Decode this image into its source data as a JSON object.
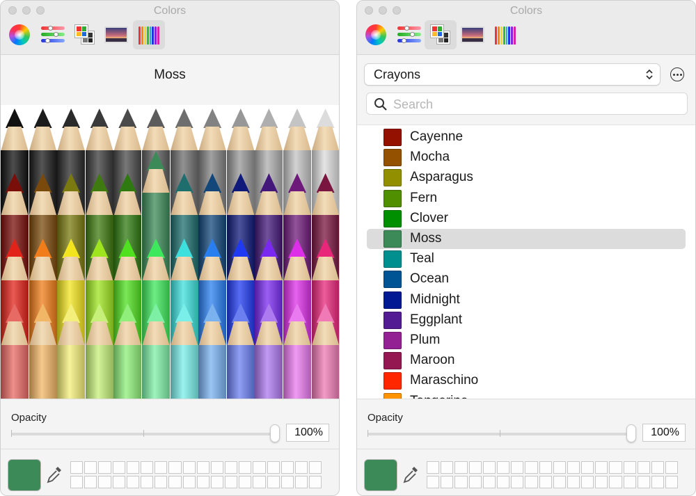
{
  "left_window": {
    "title": "Colors",
    "selected_name": "Moss",
    "opacity_label": "Opacity",
    "opacity_value": "100%",
    "opacity_fraction": 1.0,
    "current_color": "#3b8a58"
  },
  "right_window": {
    "title": "Colors",
    "list_name": "Crayons",
    "search_placeholder": "Search",
    "opacity_label": "Opacity",
    "opacity_value": "100%",
    "opacity_fraction": 1.0,
    "current_color": "#3b8a58",
    "selected_item": "Moss",
    "items": [
      {
        "name": "Cayenne",
        "color": "#941100"
      },
      {
        "name": "Mocha",
        "color": "#945200"
      },
      {
        "name": "Asparagus",
        "color": "#929000"
      },
      {
        "name": "Fern",
        "color": "#4f8f00"
      },
      {
        "name": "Clover",
        "color": "#008f00"
      },
      {
        "name": "Moss",
        "color": "#3b8a58"
      },
      {
        "name": "Teal",
        "color": "#008f8f"
      },
      {
        "name": "Ocean",
        "color": "#005493"
      },
      {
        "name": "Midnight",
        "color": "#011993"
      },
      {
        "name": "Eggplant",
        "color": "#531b93"
      },
      {
        "name": "Plum",
        "color": "#942193"
      },
      {
        "name": "Maroon",
        "color": "#941751"
      },
      {
        "name": "Maraschino",
        "color": "#ff2600"
      },
      {
        "name": "Tangerine",
        "color": "#ff9300"
      }
    ]
  },
  "toolbar_icons": [
    "color-wheel-icon",
    "color-sliders-icon",
    "color-palettes-icon",
    "image-palettes-icon",
    "pencils-icon"
  ],
  "crayon_rows": [
    [
      "#111111",
      "#1c1c1c",
      "#2a2a2a",
      "#3a3a3a",
      "#4a4a4a",
      "#5c5c5c",
      "#6e6e6e",
      "#828282",
      "#979797",
      "#aeaeae",
      "#c4c4c4",
      "#dcdcdc"
    ],
    [
      "#7a0f0a",
      "#7a4a0c",
      "#7a7a10",
      "#3f7a10",
      "#2f7a10",
      "#3b8a58",
      "#1f6e6e",
      "#13477a",
      "#101a7a",
      "#43187a",
      "#6e1a7a",
      "#7a1540"
    ],
    [
      "#e2231a",
      "#f07d1a",
      "#f2e41f",
      "#9ee51f",
      "#4fe01f",
      "#3ee85c",
      "#3ee0dd",
      "#2a7ff0",
      "#1f3af0",
      "#7a2af0",
      "#dd2fe8",
      "#e8267a"
    ],
    [
      "#e86a64",
      "#f2b766",
      "#f4ef7a",
      "#c6f07a",
      "#8fef7a",
      "#7ef0a6",
      "#7aefea",
      "#7ab2f0",
      "#6b7ff0",
      "#ad7af0",
      "#ea7aef",
      "#ef7ab5"
    ]
  ]
}
